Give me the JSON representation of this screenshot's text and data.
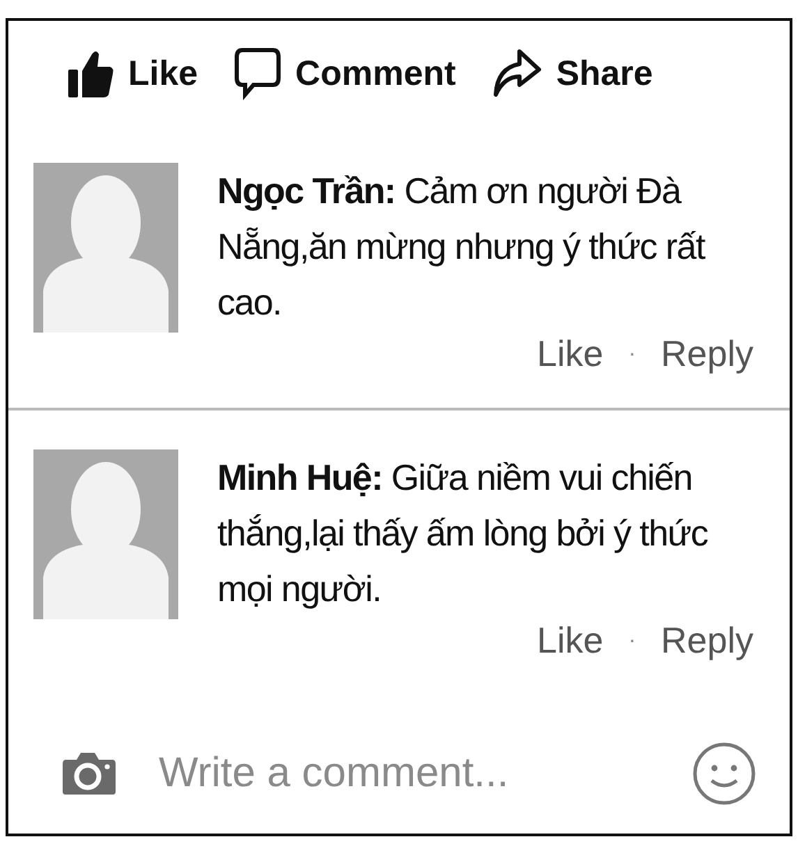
{
  "actions": [
    {
      "label": "Like",
      "kind": "like"
    },
    {
      "label": "Comment",
      "kind": "comment"
    },
    {
      "label": "Share",
      "kind": "share"
    }
  ],
  "comments": [
    {
      "text": "**Ngọc Trần:** Cảm ơn người Đà Nẵng,ăn mừng nhưng ý thức rất cao.",
      "like": "Like",
      "separator": "·",
      "reply": "Reply"
    },
    {
      "text": "**Minh Huệ:** Giữa niềm vui chiến thắng,lại thấy ấm lòng bởi ý thức mọi người.",
      "like": "Like",
      "separator": "·",
      "reply": "Reply"
    }
  ],
  "composer": {
    "placeholder": "Write a comment..."
  }
}
